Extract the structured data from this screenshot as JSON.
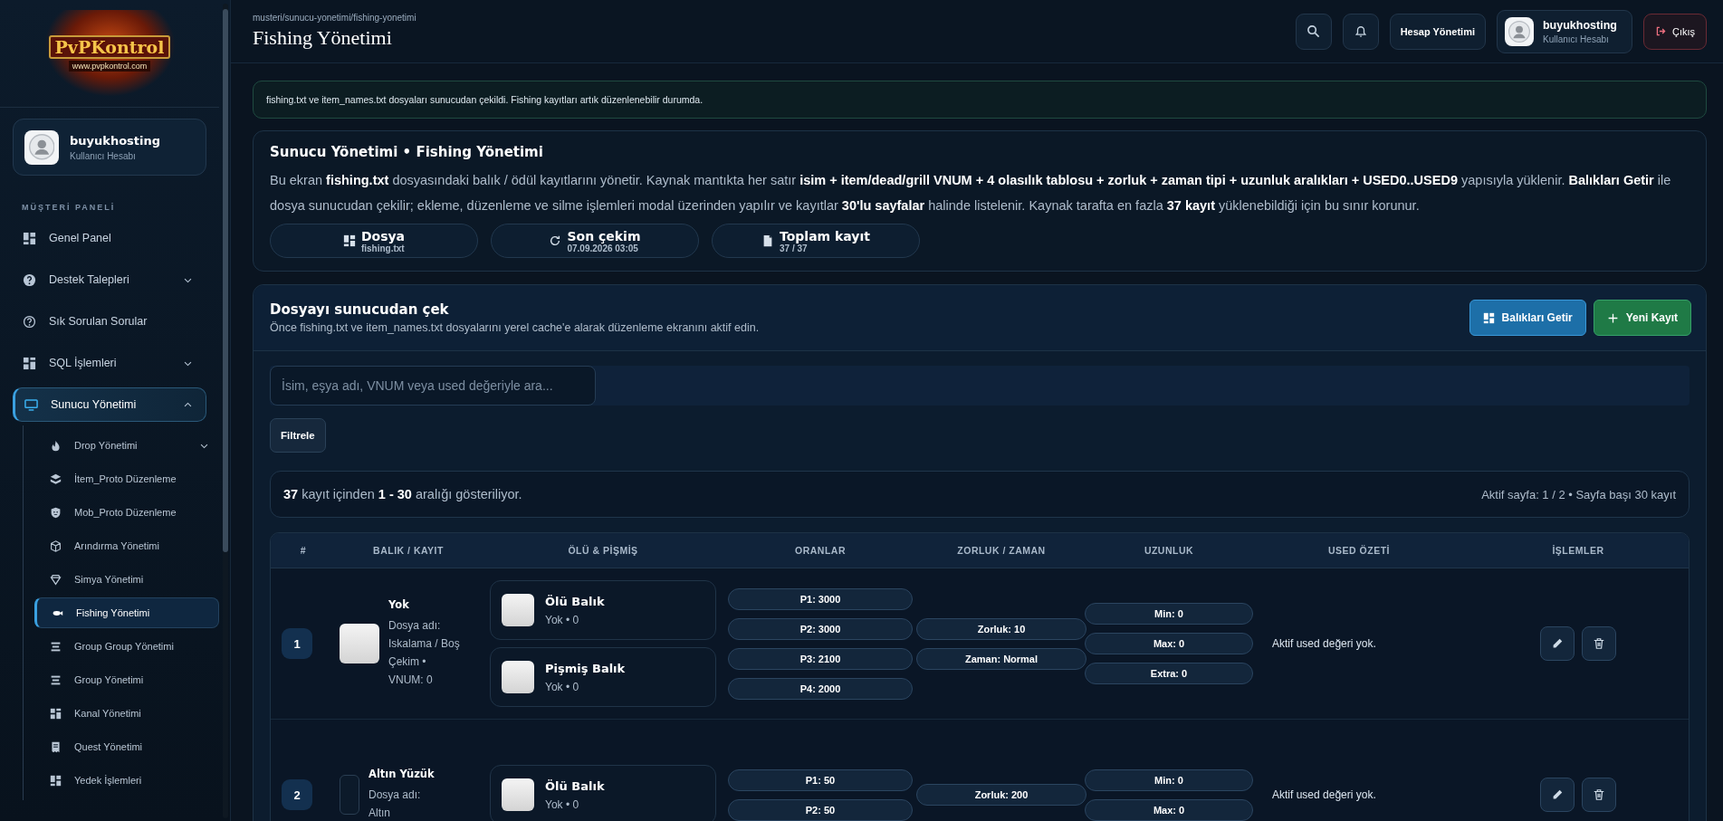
{
  "sidebar": {
    "logo": {
      "title": "PvPKontrol",
      "url": "www.pvpkontrol.com"
    },
    "user": {
      "name": "buyukhosting",
      "role": "Kullanıcı Hesabı"
    },
    "section": "MÜŞTERİ PANELİ",
    "items": [
      {
        "label": "Genel Panel",
        "selected": false
      },
      {
        "label": "Destek Talepleri",
        "selected": false,
        "expanded": false
      },
      {
        "label": "Sık Sorulan Sorular",
        "selected": false
      },
      {
        "label": "SQL İşlemleri",
        "selected": false,
        "expanded": false
      },
      {
        "label": "Sunucu Yönetimi",
        "selected": true,
        "expanded": true,
        "children": [
          {
            "label": "Drop Yönetimi",
            "selected": false,
            "expanded": false
          },
          {
            "label": "İtem_Proto Düzenleme",
            "selected": false
          },
          {
            "label": "Mob_Proto Düzenleme",
            "selected": false
          },
          {
            "label": "Arındırma Yönetimi",
            "selected": false
          },
          {
            "label": "Simya Yönetimi",
            "selected": false
          },
          {
            "label": "Fishing Yönetimi",
            "selected": true
          },
          {
            "label": "Group Group Yönetimi",
            "selected": false
          },
          {
            "label": "Group Yönetimi",
            "selected": false
          },
          {
            "label": "Kanal Yönetimi",
            "selected": false
          },
          {
            "label": "Quest Yönetimi",
            "selected": false
          },
          {
            "label": "Yedek İşlemleri",
            "selected": false
          }
        ]
      }
    ]
  },
  "header": {
    "breadcrumb": "musteri/sunucu-yonetimi/fishing-yonetimi",
    "title": "Fishing Yönetimi",
    "account_button": "Hesap Yönetimi",
    "user": {
      "name": "buyukhosting",
      "role": "Kullanıcı Hesabı"
    },
    "logout": "Çıkış"
  },
  "alert": "fishing.txt ve item_names.txt dosyaları sunucudan çekildi. Fishing kayıtları artık düzenlenebilir durumda.",
  "info": {
    "title": "Sunucu Yönetimi • Fishing Yönetimi",
    "description": "Bu ekran **fishing.txt** dosyasındaki balık / ödül kayıtlarını yönetir. Kaynak mantıkta her satır **isim + item/dead/grill VNUM + 4 olasılık tablosu + zorluk + zaman tipi + uzunluk aralıkları + USED0..USED9** yapısıyla yüklenir. **Balıkları Getir** ile dosya sunucudan çekilir; ekleme, düzenleme ve silme işlemleri modal üzerinden yapılır ve kayıtlar **30'lu sayfalar** halinde listelenir. Kaynak tarafta en fazla **37 kayıt** yüklenebildiği için bu sınır korunur.",
    "stats": [
      {
        "label": "Dosya",
        "value": "fishing.txt"
      },
      {
        "label": "Son çekim",
        "value": "07.09.2026 03:05"
      },
      {
        "label": "Toplam kayıt",
        "value": "37 / 37"
      }
    ]
  },
  "fetch_panel": {
    "title": "Dosyayı sunucudan çek",
    "subtitle": "Önce fishing.txt ve item_names.txt dosyalarını yerel cache'e alarak düzenleme ekranını aktif edin.",
    "buttons": [
      {
        "label": "Balıkları Getir",
        "kind": "primary"
      },
      {
        "label": "Yeni Kayıt",
        "kind": "success"
      }
    ],
    "search": {
      "placeholder": "İsim, eşya adı, VNUM veya used değeriyle ara..."
    },
    "filter_button": "Filtrele",
    "summary": "**37** kayıt içinden **1 - 30** aralığı gösteriliyor.",
    "page_info": "Aktif sayfa: 1 / 2 • Sayfa başı 30 kayıt"
  },
  "table": {
    "columns": [
      "#",
      "BALIK / KAYIT",
      "ÖLÜ & PİŞMİŞ",
      "ORANLAR",
      "ZORLUK / ZAMAN",
      "UZUNLUK",
      "USED ÖZETİ",
      "İŞLEMLER"
    ],
    "rows": [
      {
        "number": "1",
        "thumb_loaded": true,
        "name": "Yok",
        "note": "Dosya adı: Iskalama / Boş Çekim • VNUM: 0",
        "products": [
          {
            "title": "Ölü Balık",
            "detail": "Yok • 0"
          },
          {
            "title": "Pişmiş Balık",
            "detail": "Yok • 0"
          }
        ],
        "rates": [
          "P1: 3000",
          "P2: 3000",
          "P3: 2100",
          "P4: 2000"
        ],
        "difficulty": [
          "Zorluk: 10",
          "Zaman: Normal"
        ],
        "length": [
          "Min: 0",
          "Max: 0",
          "Extra: 0"
        ],
        "used": "Aktif used değeri yok."
      },
      {
        "number": "2",
        "thumb_loaded": false,
        "name": "Altın Yüzük",
        "note": "Dosya adı: Altın",
        "products": [
          {
            "title": "Ölü Balık",
            "detail": "Yok • 0"
          }
        ],
        "rates": [
          "P1: 50",
          "P2: 50"
        ],
        "difficulty": [
          "Zorluk: 200"
        ],
        "length": [
          "Min: 0",
          "Max: 0"
        ],
        "used": "Aktif used değeri yok."
      }
    ]
  }
}
